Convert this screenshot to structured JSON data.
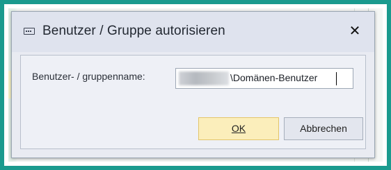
{
  "dialog": {
    "title": "Benutzer / Gruppe autorisieren",
    "icon": "textbox-icon",
    "close_symbol": "✕"
  },
  "form": {
    "label": "Benutzer- / gruppenname:",
    "value_suffix": "\\Domänen-Benutzer"
  },
  "buttons": {
    "ok_label": "OK",
    "cancel_label": "Abbrechen"
  },
  "colors": {
    "frame": "#1a9a8e",
    "ok_background": "#fbeebb",
    "dialog_background": "#e9ebf2"
  }
}
